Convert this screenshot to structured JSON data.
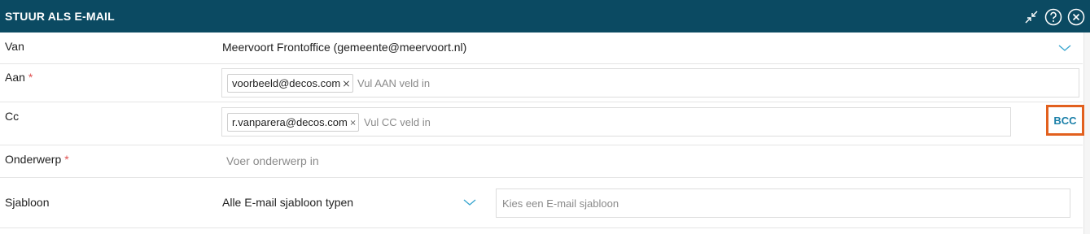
{
  "dialog": {
    "title": "STUUR ALS E-MAIL",
    "icons": [
      "collapse-icon",
      "help-icon",
      "close-icon"
    ],
    "colors": {
      "header": "#0b4a62",
      "accent": "#1a7fa8",
      "required": "#e05252",
      "highlight": "#e2601e"
    }
  },
  "form": {
    "van": {
      "label": "Van",
      "value": "Meervoort Frontoffice (gemeente@meervoort.nl)"
    },
    "aan": {
      "label": "Aan",
      "required": "*",
      "chips": [
        "voorbeeld@decos.com"
      ],
      "placeholder": "Vul AAN veld in"
    },
    "cc": {
      "label": "Cc",
      "chips": [
        "r.vanparera@decos.com"
      ],
      "placeholder": "Vul CC veld in",
      "bcc_label": "BCC"
    },
    "onderwerp": {
      "label": "Onderwerp",
      "required": "*",
      "placeholder": "Voer onderwerp in"
    },
    "sjabloon": {
      "label": "Sjabloon",
      "type_value": "Alle E-mail sjabloon typen",
      "placeholder": "Kies een E-mail sjabloon"
    }
  }
}
